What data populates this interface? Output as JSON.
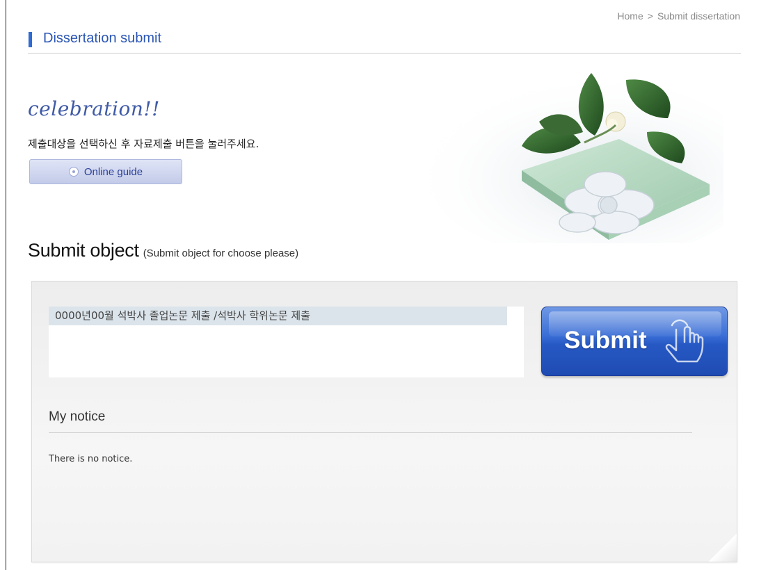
{
  "breadcrumb": {
    "home": "Home",
    "separator": ">",
    "current": "Submit dissertation"
  },
  "header": {
    "title": "Dissertation submit"
  },
  "intro": {
    "celebration": "celebration!!",
    "instruction": "제출대상을 선택하신 후 자료제출 버튼을 눌러주세요.",
    "guide_button": "Online guide"
  },
  "submit_object": {
    "heading": "Submit object",
    "hint": "(Submit object for choose please)",
    "items": [
      "0000년00월 석박사 졸업논문 제출 /석박사 학위논문 제출"
    ],
    "submit_button": "Submit"
  },
  "notice": {
    "title": "My notice",
    "empty_text": "There is no notice."
  },
  "colors": {
    "accent": "#2f6bd2",
    "title": "#2a55b3",
    "submit_button": "#2658c4",
    "selected_row": "#dbe4ea"
  }
}
